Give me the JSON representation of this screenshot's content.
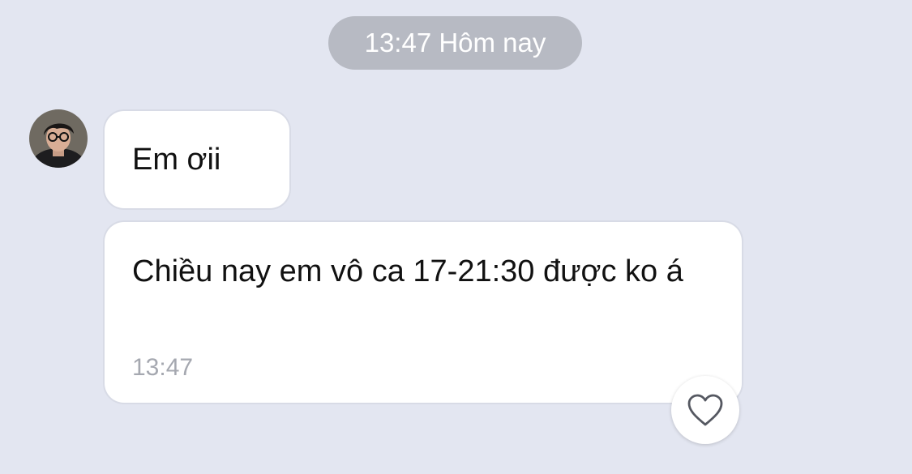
{
  "header": {
    "date_label": "13:47 Hôm nay"
  },
  "messages": [
    {
      "text": "Em ơii"
    },
    {
      "text": "Chiều nay em vô ca 17-21:30 được ko á",
      "time": "13:47"
    }
  ],
  "icons": {
    "avatar": "user-avatar-photo",
    "reaction": "heart-outline-icon"
  },
  "colors": {
    "background": "#e3e6f1",
    "date_pill": "#b7bac3",
    "bubble": "#ffffff",
    "text": "#111111",
    "timestamp": "#a5a8b0"
  }
}
